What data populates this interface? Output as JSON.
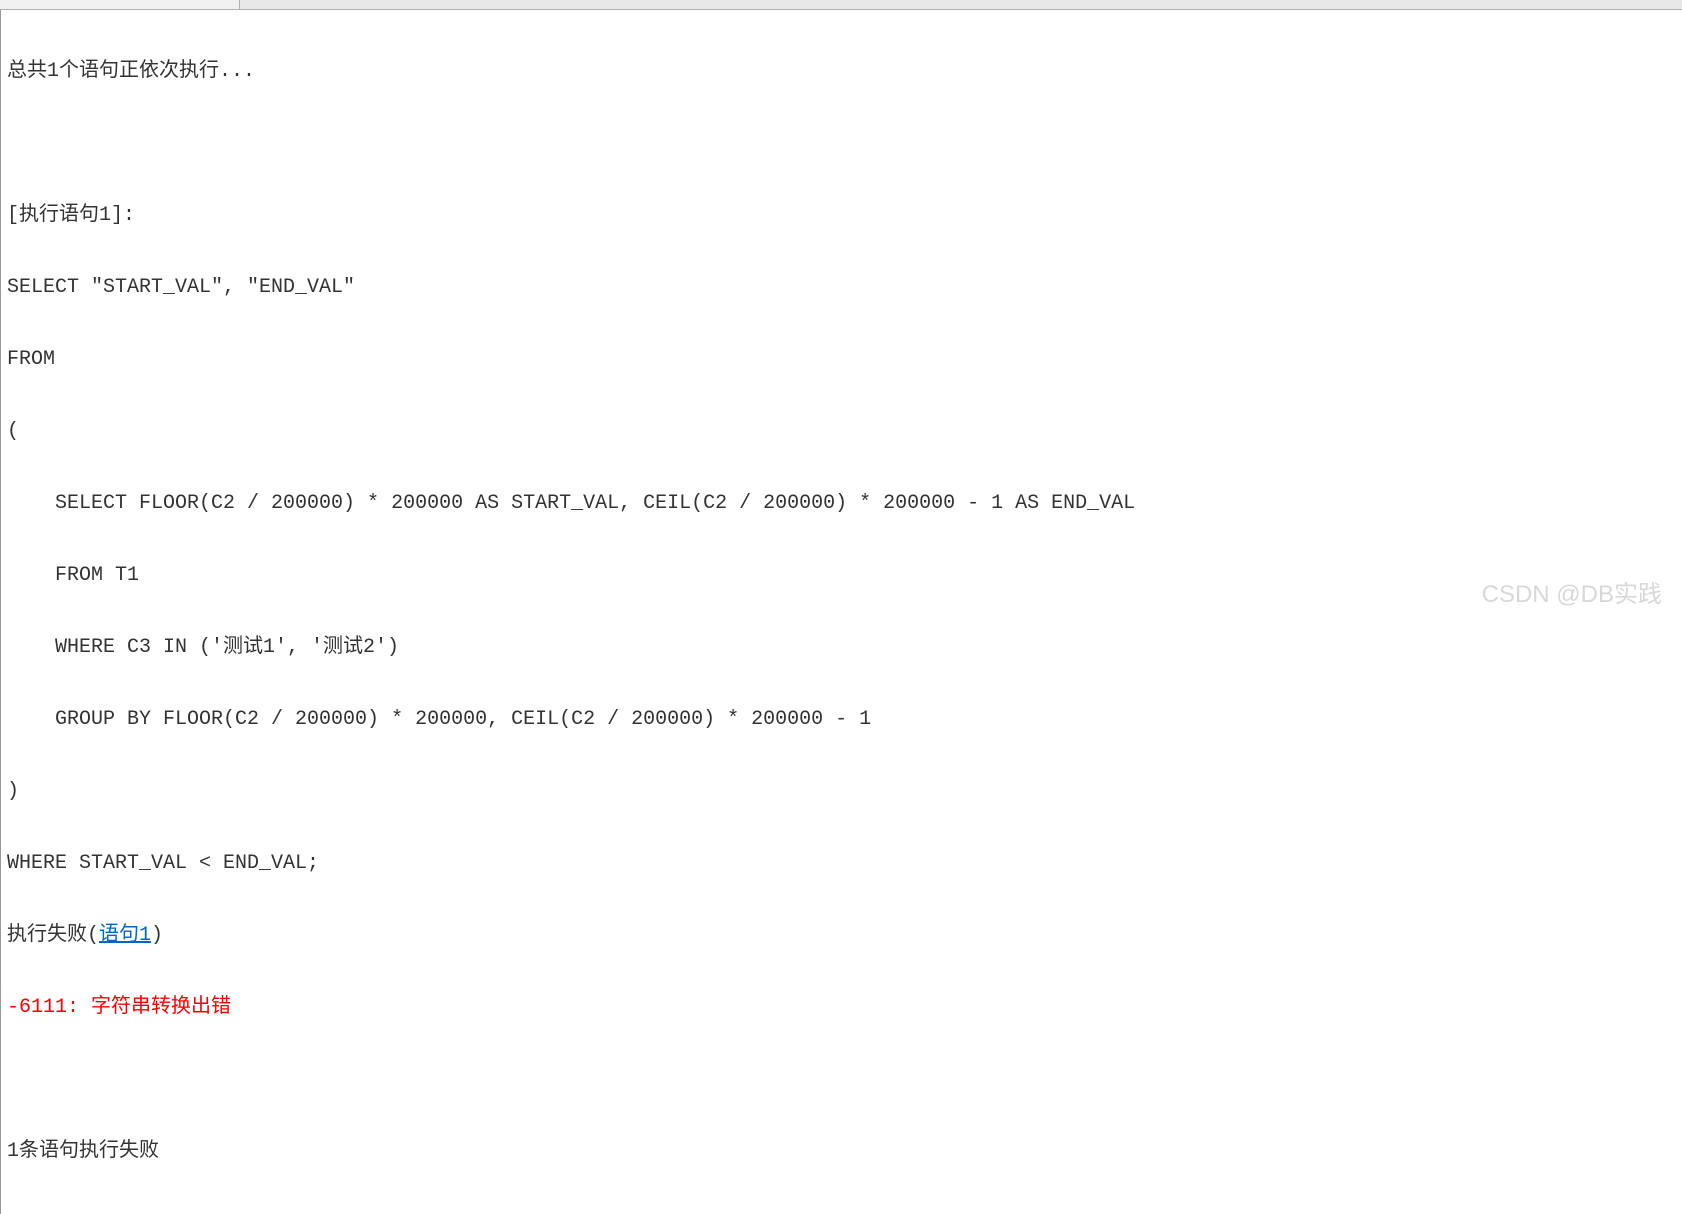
{
  "header": {
    "status": "总共1个语句正依次执行..."
  },
  "execution": {
    "label": "[执行语句1]:",
    "sql_lines": [
      "SELECT \"START_VAL\", \"END_VAL\"",
      "FROM",
      "(",
      "    SELECT FLOOR(C2 / 200000) * 200000 AS START_VAL, CEIL(C2 / 200000) * 200000 - 1 AS END_VAL",
      "    FROM T1",
      "    WHERE C3 IN ('测试1', '测试2')",
      "    GROUP BY FLOOR(C2 / 200000) * 200000, CEIL(C2 / 200000) * 200000 - 1",
      ")",
      "WHERE START_VAL < END_VAL;"
    ],
    "fail_prefix": "执行失败(",
    "fail_link": "语句1",
    "fail_suffix": ")",
    "error_message": "-6111: 字符串转换出错"
  },
  "summary": {
    "text": "1条语句执行失败"
  },
  "watermark": "CSDN @DB实践"
}
